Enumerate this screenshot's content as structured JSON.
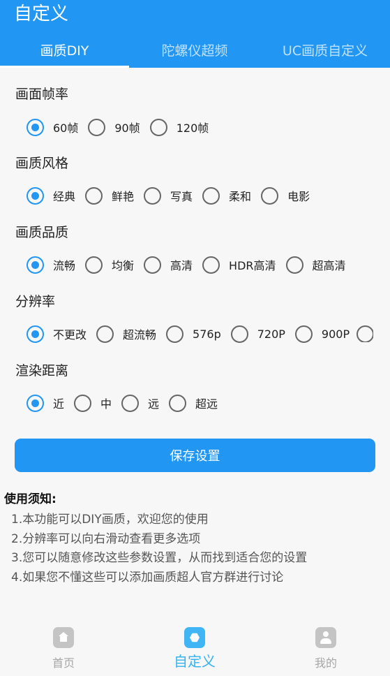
{
  "app": {
    "title": "自定义"
  },
  "tabs": [
    {
      "label": "画质DIY"
    },
    {
      "label": "陀螺仪超频"
    },
    {
      "label": "UC画质自定义"
    }
  ],
  "sections": {
    "fps": {
      "title": "画面帧率",
      "options": [
        "60帧",
        "90帧",
        "120帧"
      ],
      "selected": "60帧"
    },
    "style": {
      "title": "画质风格",
      "options": [
        "经典",
        "鲜艳",
        "写真",
        "柔和",
        "电影"
      ],
      "selected": "经典"
    },
    "quality": {
      "title": "画质品质",
      "options": [
        "流畅",
        "均衡",
        "高清",
        "HDR高清",
        "超高清"
      ],
      "selected": "流畅"
    },
    "resolution": {
      "title": "分辨率",
      "options": [
        "不更改",
        "超流畅",
        "576p",
        "720P",
        "900P"
      ],
      "selected": "不更改"
    },
    "distance": {
      "title": "渲染距离",
      "options": [
        "近",
        "中",
        "远",
        "超远"
      ],
      "selected": "近"
    }
  },
  "save_button": "保存设置",
  "notice": {
    "title": "使用须知:",
    "lines": [
      "1.本功能可以DIY画质，欢迎您的使用",
      "2.分辨率可以向右滑动查看更多选项",
      "3.您可以随意修改这些参数设置，从而找到适合您的设置",
      "4.如果您不懂这些可以添加画质超人官方群进行讨论"
    ]
  },
  "bottom_nav": [
    {
      "label": "首页",
      "icon": "home-icon"
    },
    {
      "label": "自定义",
      "icon": "customize-icon"
    },
    {
      "label": "我的",
      "icon": "profile-icon"
    }
  ],
  "colors": {
    "primary": "#2196f3",
    "nav_active": "#33b3f2",
    "radio_off": "#666666"
  }
}
